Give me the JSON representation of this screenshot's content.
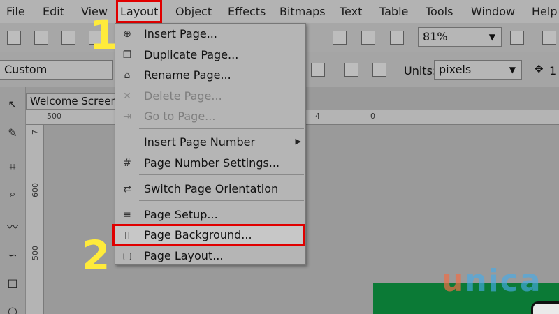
{
  "menubar": {
    "items": [
      "File",
      "Edit",
      "View",
      "Layout",
      "Object",
      "Effects",
      "Bitmaps",
      "Text",
      "Table",
      "Tools",
      "Window",
      "Help"
    ]
  },
  "toolbar": {
    "zoom": "81%",
    "preset": "Custom",
    "units_label": "Units:",
    "units_value": "pixels",
    "trailing_value": "1"
  },
  "document": {
    "tab_title": "Welcome Screen",
    "hruler": [
      "500",
      "4",
      "0"
    ],
    "vruler": [
      "7",
      "600",
      "500"
    ]
  },
  "layout_menu": {
    "items": [
      {
        "label": "Insert Page...",
        "icon": "insert-page-icon",
        "enabled": true
      },
      {
        "label": "Duplicate Page...",
        "icon": "duplicate-page-icon",
        "enabled": true
      },
      {
        "label": "Rename Page...",
        "icon": "rename-page-icon",
        "enabled": true
      },
      {
        "label": "Delete Page...",
        "icon": "delete-page-icon",
        "enabled": false
      },
      {
        "label": "Go to Page...",
        "icon": "go-to-page-icon",
        "enabled": false
      },
      {
        "label": "Insert Page Number",
        "icon": "",
        "enabled": true,
        "submenu": true
      },
      {
        "label": "Page Number Settings...",
        "icon": "page-number-settings-icon",
        "enabled": true
      },
      {
        "label": "Switch Page Orientation",
        "icon": "switch-orientation-icon",
        "enabled": true
      },
      {
        "label": "Page Setup...",
        "icon": "page-setup-icon",
        "enabled": true
      },
      {
        "label": "Page Background...",
        "icon": "page-background-icon",
        "enabled": true,
        "highlighted": true
      },
      {
        "label": "Page Layout...",
        "icon": "page-layout-icon",
        "enabled": true
      }
    ]
  },
  "annotations": {
    "step1": "1",
    "step2": "2",
    "highlight_color": "#e00000",
    "step_color": "#ffeb3b"
  },
  "watermark": {
    "u": "u",
    "rest": "nica"
  }
}
